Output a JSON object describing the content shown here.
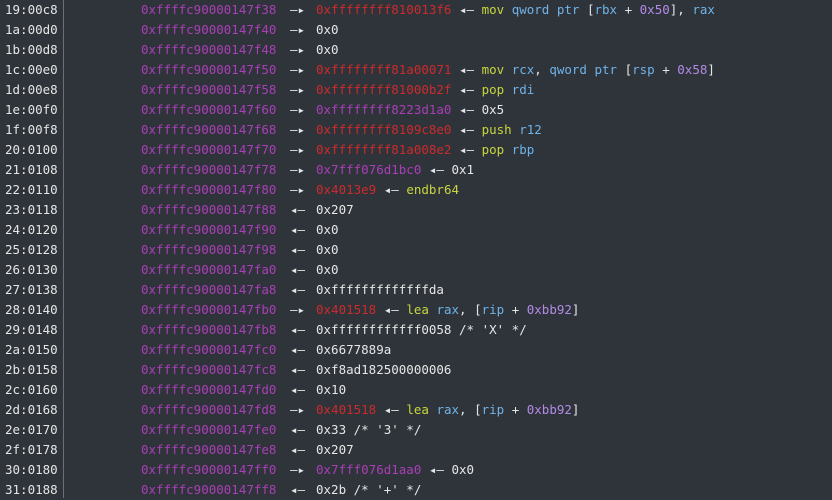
{
  "colors": {
    "background": "#2f343b",
    "address": "#a93fb6",
    "code_pointer": "#cc2b2b",
    "instruction": "#c7d63d",
    "register": "#6fb3e8",
    "immediate": "#b38ae6",
    "text": "#e6e6e6"
  },
  "rows": [
    {
      "off": "19:00c8",
      "addr": "0xffffc90000147f38",
      "arrow": "—▸",
      "val": "0xffffffff810013f6",
      "vcolor": "red",
      "tail": [
        [
          "w",
          "◂— "
        ],
        [
          "ins",
          "mov "
        ],
        [
          "reg",
          "qword ptr "
        ],
        [
          "w",
          "["
        ],
        [
          "reg",
          "rbx"
        ],
        [
          "w",
          " + "
        ],
        [
          "num",
          "0x50"
        ],
        [
          "w",
          "], "
        ],
        [
          "reg",
          "rax"
        ]
      ]
    },
    {
      "off": "1a:00d0",
      "addr": "0xffffc90000147f40",
      "arrow": "—▸",
      "val": "0x0",
      "vcolor": "plain",
      "tail": []
    },
    {
      "off": "1b:00d8",
      "addr": "0xffffc90000147f48",
      "arrow": "—▸",
      "val": "0x0",
      "vcolor": "plain",
      "tail": []
    },
    {
      "off": "1c:00e0",
      "addr": "0xffffc90000147f50",
      "arrow": "—▸",
      "val": "0xffffffff81a00071",
      "vcolor": "red",
      "tail": [
        [
          "w",
          "◂— "
        ],
        [
          "ins",
          "mov "
        ],
        [
          "reg",
          "rcx"
        ],
        [
          "w",
          ", "
        ],
        [
          "reg",
          "qword ptr "
        ],
        [
          "w",
          "["
        ],
        [
          "reg",
          "rsp"
        ],
        [
          "w",
          " + "
        ],
        [
          "num",
          "0x58"
        ],
        [
          "w",
          "]"
        ]
      ]
    },
    {
      "off": "1d:00e8",
      "addr": "0xffffc90000147f58",
      "arrow": "—▸",
      "val": "0xffffffff81000b2f",
      "vcolor": "red",
      "tail": [
        [
          "w",
          "◂— "
        ],
        [
          "ins",
          "pop "
        ],
        [
          "reg",
          "rdi"
        ]
      ]
    },
    {
      "off": "1e:00f0",
      "addr": "0xffffc90000147f60",
      "arrow": "—▸",
      "val": "0xffffffff8223d1a0",
      "vcolor": "purple",
      "tail": [
        [
          "w",
          "◂— "
        ],
        [
          "w",
          "0x5"
        ]
      ]
    },
    {
      "off": "1f:00f8",
      "addr": "0xffffc90000147f68",
      "arrow": "—▸",
      "val": "0xffffffff8109c8e0",
      "vcolor": "red",
      "tail": [
        [
          "w",
          "◂— "
        ],
        [
          "ins",
          "push "
        ],
        [
          "reg",
          "r12"
        ]
      ]
    },
    {
      "off": "20:0100",
      "addr": "0xffffc90000147f70",
      "arrow": "—▸",
      "val": "0xffffffff81a008e2",
      "vcolor": "red",
      "tail": [
        [
          "w",
          "◂— "
        ],
        [
          "ins",
          "pop "
        ],
        [
          "reg",
          "rbp"
        ]
      ]
    },
    {
      "off": "21:0108",
      "addr": "0xffffc90000147f78",
      "arrow": "—▸",
      "val": "0x7fff076d1bc0",
      "vcolor": "purple",
      "tail": [
        [
          "w",
          "◂— "
        ],
        [
          "w",
          "0x1"
        ]
      ]
    },
    {
      "off": "22:0110",
      "addr": "0xffffc90000147f80",
      "arrow": "—▸",
      "val": "0x4013e9",
      "vcolor": "red",
      "tail": [
        [
          "w",
          "◂— "
        ],
        [
          "ins",
          "endbr64"
        ]
      ]
    },
    {
      "off": "23:0118",
      "addr": "0xffffc90000147f88",
      "arrow": "◂—",
      "val": "0x207",
      "vcolor": "plain",
      "tail": []
    },
    {
      "off": "24:0120",
      "addr": "0xffffc90000147f90",
      "arrow": "◂—",
      "val": "0x0",
      "vcolor": "plain",
      "tail": []
    },
    {
      "off": "25:0128",
      "addr": "0xffffc90000147f98",
      "arrow": "◂—",
      "val": "0x0",
      "vcolor": "plain",
      "tail": []
    },
    {
      "off": "26:0130",
      "addr": "0xffffc90000147fa0",
      "arrow": "◂—",
      "val": "0x0",
      "vcolor": "plain",
      "tail": []
    },
    {
      "off": "27:0138",
      "addr": "0xffffc90000147fa8",
      "arrow": "◂—",
      "val": "0xfffffffffffffda",
      "vcolor": "plain",
      "tail": []
    },
    {
      "off": "28:0140",
      "addr": "0xffffc90000147fb0",
      "arrow": "—▸",
      "val": "0x401518",
      "vcolor": "red",
      "tail": [
        [
          "w",
          "◂— "
        ],
        [
          "ins",
          "lea "
        ],
        [
          "reg",
          "rax"
        ],
        [
          "w",
          ", ["
        ],
        [
          "reg",
          "rip"
        ],
        [
          "w",
          " + "
        ],
        [
          "num",
          "0xbb92"
        ],
        [
          "w",
          "]"
        ]
      ]
    },
    {
      "off": "29:0148",
      "addr": "0xffffc90000147fb8",
      "arrow": "◂—",
      "val": "0xffffffffffff0058 /* 'X' */",
      "vcolor": "plain",
      "tail": []
    },
    {
      "off": "2a:0150",
      "addr": "0xffffc90000147fc0",
      "arrow": "◂—",
      "val": "0x6677889a",
      "vcolor": "plain",
      "tail": []
    },
    {
      "off": "2b:0158",
      "addr": "0xffffc90000147fc8",
      "arrow": "◂—",
      "val": "0xf8ad182500000006",
      "vcolor": "plain",
      "tail": []
    },
    {
      "off": "2c:0160",
      "addr": "0xffffc90000147fd0",
      "arrow": "◂—",
      "val": "0x10",
      "vcolor": "plain",
      "tail": []
    },
    {
      "off": "2d:0168",
      "addr": "0xffffc90000147fd8",
      "arrow": "—▸",
      "val": "0x401518",
      "vcolor": "red",
      "tail": [
        [
          "w",
          "◂— "
        ],
        [
          "ins",
          "lea "
        ],
        [
          "reg",
          "rax"
        ],
        [
          "w",
          ", ["
        ],
        [
          "reg",
          "rip"
        ],
        [
          "w",
          " + "
        ],
        [
          "num",
          "0xbb92"
        ],
        [
          "w",
          "]"
        ]
      ]
    },
    {
      "off": "2e:0170",
      "addr": "0xffffc90000147fe0",
      "arrow": "◂—",
      "val": "0x33 /* '3' */",
      "vcolor": "plain",
      "tail": []
    },
    {
      "off": "2f:0178",
      "addr": "0xffffc90000147fe8",
      "arrow": "◂—",
      "val": "0x207",
      "vcolor": "plain",
      "tail": []
    },
    {
      "off": "30:0180",
      "addr": "0xffffc90000147ff0",
      "arrow": "—▸",
      "val": "0x7fff076d1aa0",
      "vcolor": "purple",
      "tail": [
        [
          "w",
          "◂— "
        ],
        [
          "w",
          "0x0"
        ]
      ]
    },
    {
      "off": "31:0188",
      "addr": "0xffffc90000147ff8",
      "arrow": "◂—",
      "val": "0x2b /* '+' */",
      "vcolor": "plain",
      "tail": []
    }
  ]
}
